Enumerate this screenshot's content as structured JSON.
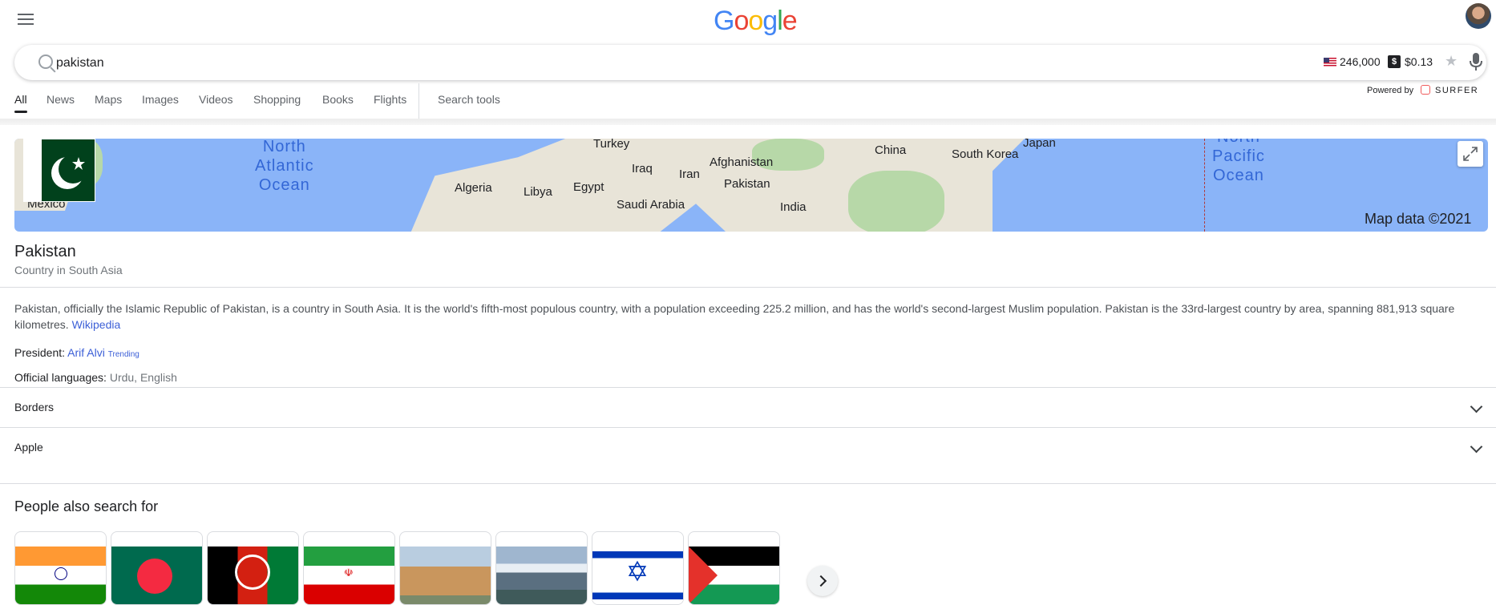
{
  "header": {
    "logo_letters": [
      {
        "char": "G",
        "color": "#4285f4"
      },
      {
        "char": "o",
        "color": "#ea4335"
      },
      {
        "char": "o",
        "color": "#fbbc05"
      },
      {
        "char": "g",
        "color": "#4285f4"
      },
      {
        "char": "l",
        "color": "#34a853"
      },
      {
        "char": "e",
        "color": "#ea4335"
      }
    ]
  },
  "search": {
    "query": "pakistan",
    "volume": "246,000",
    "cpc_icon": "$",
    "cpc": "$0.13",
    "powered_by": "Powered by",
    "surfer": "SURFER"
  },
  "tabs": [
    {
      "label": "All",
      "active": true
    },
    {
      "label": "News"
    },
    {
      "label": "Maps"
    },
    {
      "label": "Images"
    },
    {
      "label": "Videos"
    },
    {
      "label": "Shopping"
    },
    {
      "label": "Books"
    },
    {
      "label": "Flights"
    },
    {
      "label": "Search tools"
    }
  ],
  "map": {
    "labels": [
      "Turkey",
      "Japan",
      "China",
      "South Korea",
      "Iraq",
      "Iran",
      "Afghanistan",
      "Algeria",
      "Libya",
      "Egypt",
      "Pakistan",
      "Saudi Arabia",
      "India",
      "Mexico"
    ],
    "oceans": [
      "North\nAtlantic\nOcean",
      "North\nPacific\nOcean"
    ],
    "attribution": "Map data ©2021"
  },
  "entity": {
    "title": "Pakistan",
    "subtitle": "Country in South Asia",
    "description": "Pakistan, officially the Islamic Republic of Pakistan, is a country in South Asia. It is the world's fifth-most populous country, with a population exceeding 225.2 million, and has the world's second-largest Muslim population. Pakistan is the 33rd-largest country by area, spanning 881,913 square kilometres.",
    "source": "Wikipedia",
    "president_label": "President:",
    "president": "Arif Alvi",
    "trending": "Trending",
    "languages_label": "Official languages:",
    "languages": "Urdu, English"
  },
  "accordions": [
    "Borders",
    "Apple"
  ],
  "people_also_search": {
    "heading": "People also search for",
    "cards": [
      "india-flag",
      "bangladesh-flag",
      "afghanistan-flag",
      "iran-flag",
      "building-photo",
      "city-photo",
      "israel-flag",
      "palestine-flag"
    ]
  }
}
